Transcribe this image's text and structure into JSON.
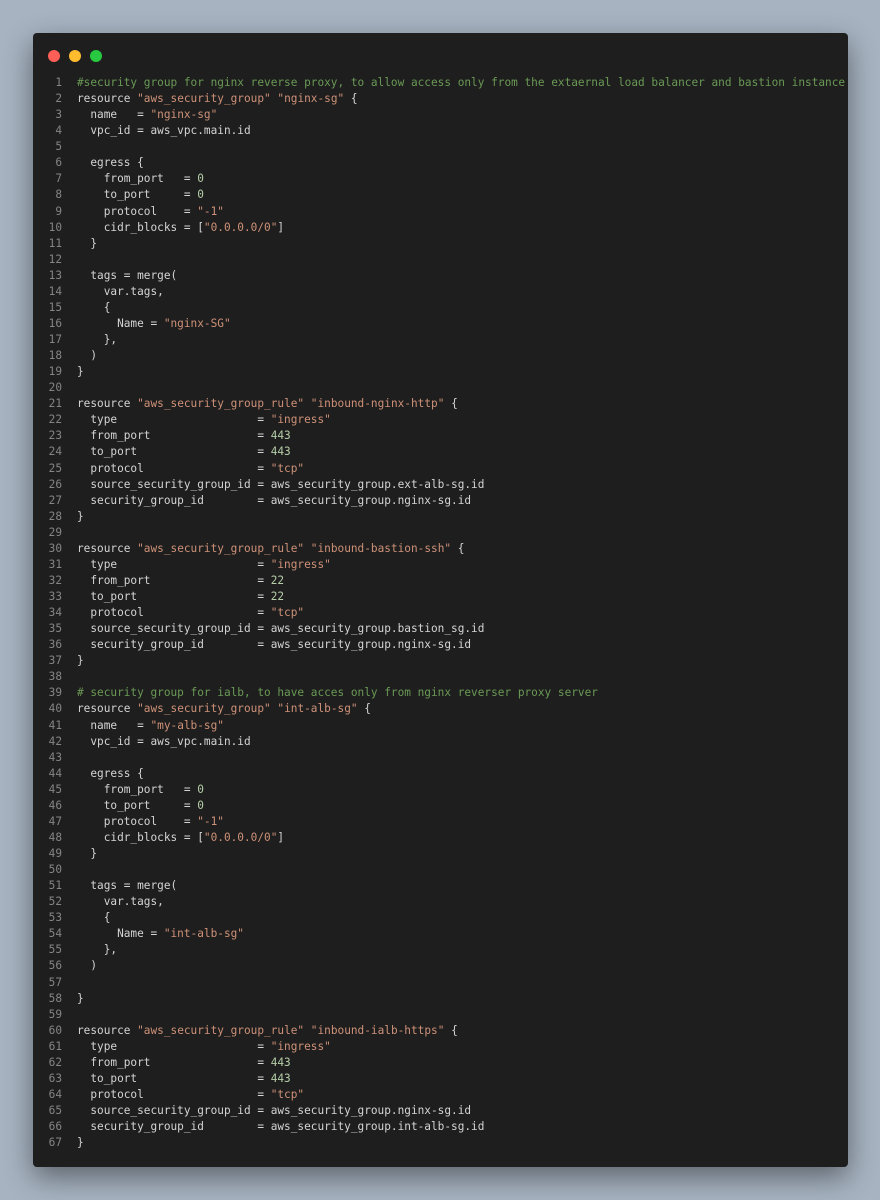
{
  "window": {
    "buttons": {
      "close": "close",
      "minimize": "minimize",
      "maximize": "maximize"
    },
    "colors": {
      "background": "#1e1e1e",
      "comment": "#6a9955",
      "string": "#ce9178",
      "number": "#b5cea8",
      "text": "#d4d4d4",
      "line_number": "#858585"
    }
  },
  "lines": [
    [
      [
        "c",
        "#security group for nginx reverse proxy, to allow access only from the extaernal load balancer and bastion instance"
      ]
    ],
    [
      [
        "p",
        "resource "
      ],
      [
        "s",
        "\"aws_security_group\""
      ],
      [
        "p",
        " "
      ],
      [
        "s",
        "\"nginx-sg\""
      ],
      [
        "p",
        " {"
      ]
    ],
    [
      [
        "p",
        "  name   = "
      ],
      [
        "s",
        "\"nginx-sg\""
      ]
    ],
    [
      [
        "p",
        "  vpc_id = aws_vpc.main.id"
      ]
    ],
    [],
    [
      [
        "p",
        "  egress {"
      ]
    ],
    [
      [
        "p",
        "    from_port   = "
      ],
      [
        "n",
        "0"
      ]
    ],
    [
      [
        "p",
        "    to_port     = "
      ],
      [
        "n",
        "0"
      ]
    ],
    [
      [
        "p",
        "    protocol    = "
      ],
      [
        "s",
        "\"-1\""
      ]
    ],
    [
      [
        "p",
        "    cidr_blocks = ["
      ],
      [
        "s",
        "\"0.0.0.0/0\""
      ],
      [
        "p",
        "]"
      ]
    ],
    [
      [
        "p",
        "  }"
      ]
    ],
    [],
    [
      [
        "p",
        "  tags = merge("
      ]
    ],
    [
      [
        "p",
        "    var.tags,"
      ]
    ],
    [
      [
        "p",
        "    {"
      ]
    ],
    [
      [
        "p",
        "      Name = "
      ],
      [
        "s",
        "\"nginx-SG\""
      ]
    ],
    [
      [
        "p",
        "    },"
      ]
    ],
    [
      [
        "p",
        "  )"
      ]
    ],
    [
      [
        "p",
        "}"
      ]
    ],
    [],
    [
      [
        "p",
        "resource "
      ],
      [
        "s",
        "\"aws_security_group_rule\""
      ],
      [
        "p",
        " "
      ],
      [
        "s",
        "\"inbound-nginx-http\""
      ],
      [
        "p",
        " {"
      ]
    ],
    [
      [
        "p",
        "  type                     = "
      ],
      [
        "s",
        "\"ingress\""
      ]
    ],
    [
      [
        "p",
        "  from_port                = "
      ],
      [
        "n",
        "443"
      ]
    ],
    [
      [
        "p",
        "  to_port                  = "
      ],
      [
        "n",
        "443"
      ]
    ],
    [
      [
        "p",
        "  protocol                 = "
      ],
      [
        "s",
        "\"tcp\""
      ]
    ],
    [
      [
        "p",
        "  source_security_group_id = aws_security_group.ext-alb-sg.id"
      ]
    ],
    [
      [
        "p",
        "  security_group_id        = aws_security_group.nginx-sg.id"
      ]
    ],
    [
      [
        "p",
        "}"
      ]
    ],
    [],
    [
      [
        "p",
        "resource "
      ],
      [
        "s",
        "\"aws_security_group_rule\""
      ],
      [
        "p",
        " "
      ],
      [
        "s",
        "\"inbound-bastion-ssh\""
      ],
      [
        "p",
        " {"
      ]
    ],
    [
      [
        "p",
        "  type                     = "
      ],
      [
        "s",
        "\"ingress\""
      ]
    ],
    [
      [
        "p",
        "  from_port                = "
      ],
      [
        "n",
        "22"
      ]
    ],
    [
      [
        "p",
        "  to_port                  = "
      ],
      [
        "n",
        "22"
      ]
    ],
    [
      [
        "p",
        "  protocol                 = "
      ],
      [
        "s",
        "\"tcp\""
      ]
    ],
    [
      [
        "p",
        "  source_security_group_id = aws_security_group.bastion_sg.id"
      ]
    ],
    [
      [
        "p",
        "  security_group_id        = aws_security_group.nginx-sg.id"
      ]
    ],
    [
      [
        "p",
        "}"
      ]
    ],
    [],
    [
      [
        "c",
        "# security group for ialb, to have acces only from nginx reverser proxy server"
      ]
    ],
    [
      [
        "p",
        "resource "
      ],
      [
        "s",
        "\"aws_security_group\""
      ],
      [
        "p",
        " "
      ],
      [
        "s",
        "\"int-alb-sg\""
      ],
      [
        "p",
        " {"
      ]
    ],
    [
      [
        "p",
        "  name   = "
      ],
      [
        "s",
        "\"my-alb-sg\""
      ]
    ],
    [
      [
        "p",
        "  vpc_id = aws_vpc.main.id"
      ]
    ],
    [],
    [
      [
        "p",
        "  egress {"
      ]
    ],
    [
      [
        "p",
        "    from_port   = "
      ],
      [
        "n",
        "0"
      ]
    ],
    [
      [
        "p",
        "    to_port     = "
      ],
      [
        "n",
        "0"
      ]
    ],
    [
      [
        "p",
        "    protocol    = "
      ],
      [
        "s",
        "\"-1\""
      ]
    ],
    [
      [
        "p",
        "    cidr_blocks = ["
      ],
      [
        "s",
        "\"0.0.0.0/0\""
      ],
      [
        "p",
        "]"
      ]
    ],
    [
      [
        "p",
        "  }"
      ]
    ],
    [],
    [
      [
        "p",
        "  tags = merge("
      ]
    ],
    [
      [
        "p",
        "    var.tags,"
      ]
    ],
    [
      [
        "p",
        "    {"
      ]
    ],
    [
      [
        "p",
        "      Name = "
      ],
      [
        "s",
        "\"int-alb-sg\""
      ]
    ],
    [
      [
        "p",
        "    },"
      ]
    ],
    [
      [
        "p",
        "  )"
      ]
    ],
    [],
    [
      [
        "p",
        "}"
      ]
    ],
    [],
    [
      [
        "p",
        "resource "
      ],
      [
        "s",
        "\"aws_security_group_rule\""
      ],
      [
        "p",
        " "
      ],
      [
        "s",
        "\"inbound-ialb-https\""
      ],
      [
        "p",
        " {"
      ]
    ],
    [
      [
        "p",
        "  type                     = "
      ],
      [
        "s",
        "\"ingress\""
      ]
    ],
    [
      [
        "p",
        "  from_port                = "
      ],
      [
        "n",
        "443"
      ]
    ],
    [
      [
        "p",
        "  to_port                  = "
      ],
      [
        "n",
        "443"
      ]
    ],
    [
      [
        "p",
        "  protocol                 = "
      ],
      [
        "s",
        "\"tcp\""
      ]
    ],
    [
      [
        "p",
        "  source_security_group_id = aws_security_group.nginx-sg.id"
      ]
    ],
    [
      [
        "p",
        "  security_group_id        = aws_security_group.int-alb-sg.id"
      ]
    ],
    [
      [
        "p",
        "}"
      ]
    ]
  ]
}
